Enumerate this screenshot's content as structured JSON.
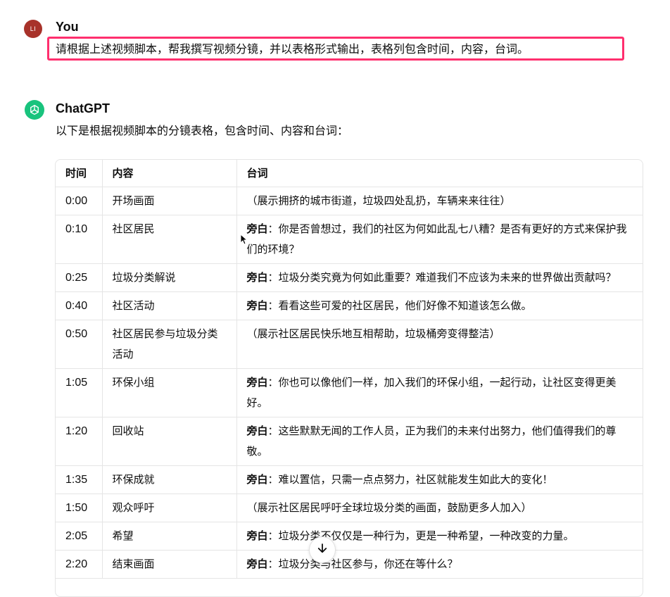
{
  "user": {
    "avatar_initials": "LI",
    "name": "You",
    "message": "请根据上述视频脚本，帮我撰写视频分镜，并以表格形式输出，表格列包含时间，内容，台词。"
  },
  "assistant": {
    "name": "ChatGPT",
    "intro": "以下是根据视频脚本的分镜表格，包含时间、内容和台词："
  },
  "table": {
    "headers": [
      "时间",
      "内容",
      "台词"
    ],
    "rows": [
      {
        "time": "0:00",
        "content": "开场画面",
        "speaker": "",
        "line": "（展示拥挤的城市街道，垃圾四处乱扔，车辆来来往往）"
      },
      {
        "time": "0:10",
        "content": "社区居民",
        "speaker": "旁白",
        "line": "：你是否曾想过，我们的社区为何如此乱七八糟？是否有更好的方式来保护我们的环境？"
      },
      {
        "time": "0:25",
        "content": "垃圾分类解说",
        "speaker": "旁白",
        "line": "：垃圾分类究竟为何如此重要？难道我们不应该为未来的世界做出贡献吗？"
      },
      {
        "time": "0:40",
        "content": "社区活动",
        "speaker": "旁白",
        "line": "：看看这些可爱的社区居民，他们好像不知道该怎么做。"
      },
      {
        "time": "0:50",
        "content": "社区居民参与垃圾分类活动",
        "speaker": "",
        "line": "（展示社区居民快乐地互相帮助，垃圾桶旁变得整洁）"
      },
      {
        "time": "1:05",
        "content": "环保小组",
        "speaker": "旁白",
        "line": "：你也可以像他们一样，加入我们的环保小组，一起行动，让社区变得更美好。"
      },
      {
        "time": "1:20",
        "content": "回收站",
        "speaker": "旁白",
        "line": "：这些默默无闻的工作人员，正为我们的未来付出努力，他们值得我们的尊敬。"
      },
      {
        "time": "1:35",
        "content": "环保成就",
        "speaker": "旁白",
        "line": "：难以置信，只需一点点努力，社区就能发生如此大的变化！"
      },
      {
        "time": "1:50",
        "content": "观众呼吁",
        "speaker": "",
        "line": "（展示社区居民呼吁全球垃圾分类的画面，鼓励更多人加入）"
      },
      {
        "time": "2:05",
        "content": "希望",
        "speaker": "旁白",
        "line": "：垃圾分类不仅仅是一种行为，更是一种希望，一种改变的力量。"
      },
      {
        "time": "2:20",
        "content": "结束画面",
        "speaker": "旁白",
        "line": "：垃圾分类与社区参与，你还在等什么？"
      }
    ]
  },
  "icons": {
    "scroll": "arrow-down-icon",
    "assistant_logo": "openai-logo-icon",
    "cursor": "mouse-pointer-icon"
  },
  "colors": {
    "highlight_border": "#ff2f6e",
    "user_avatar": "#a8322a",
    "assistant_logo": "#19c37d"
  }
}
